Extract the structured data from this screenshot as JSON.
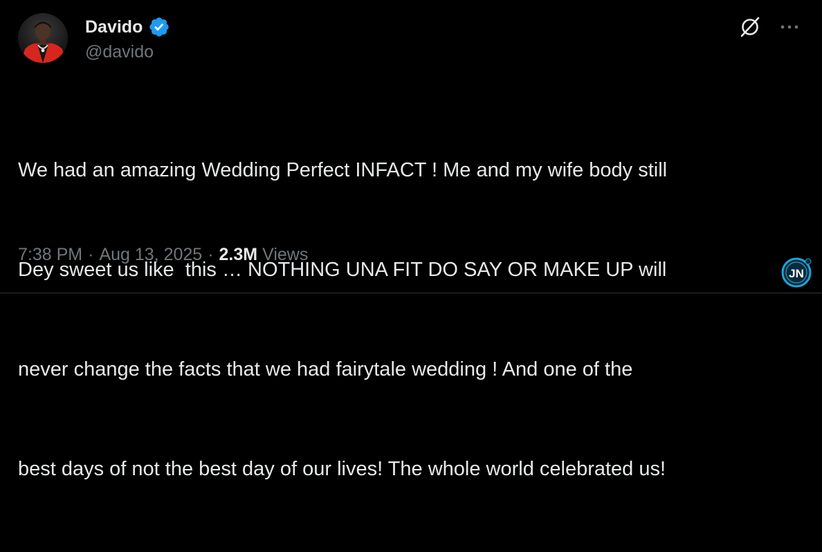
{
  "author": {
    "display_name": "Davido",
    "handle": "@davido",
    "verified": true,
    "verified_color": "#1d9bf0"
  },
  "tweet": {
    "text_lines": [
      "We had an amazing Wedding Perfect INFACT ! Me and my wife body still",
      "Dey sweet us like  this … NOTHING UNA FIT DO SAY OR MAKE UP will",
      "never change the facts that we had fairytale wedding ! And one of the",
      "best days of not the best day of our lives! The whole world celebrated us!"
    ]
  },
  "meta": {
    "time": "7:38 PM",
    "separator": "·",
    "date": "Aug 13, 2025",
    "views_count": "2.3M",
    "views_label": "Views"
  },
  "icons": {
    "verified": "verified-badge-icon",
    "grok": "grok-icon",
    "more": "more-options-icon",
    "watermark": "jn-logo"
  },
  "watermark": {
    "label": "JN"
  },
  "colors": {
    "background": "#000000",
    "text_primary": "#e7e9ea",
    "text_secondary": "#71767b",
    "accent": "#1d9bf0"
  }
}
